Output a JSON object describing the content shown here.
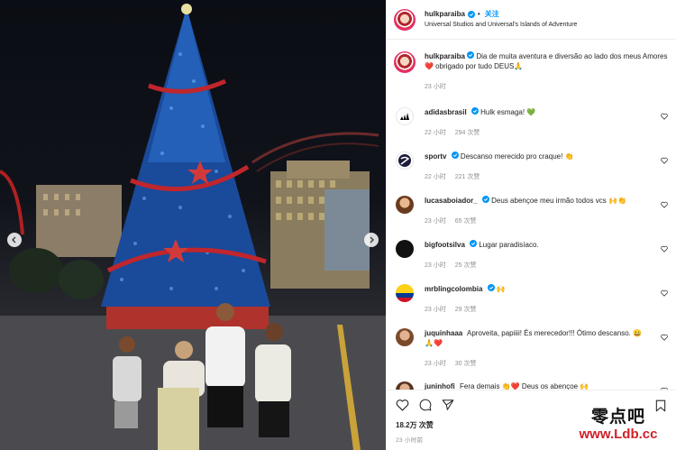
{
  "header": {
    "username": "hulkparaiba",
    "follow_label": "关注",
    "location": "Universal Studios and Universal's Islands of Adventure"
  },
  "caption": {
    "username": "hulkparaiba",
    "text": "Dia de muita aventura e diversão ao lado dos meus Amores❤️ obrigado por tudo DEUS🙏",
    "time": "23 小时"
  },
  "comments": [
    {
      "username": "adidasbrasil",
      "verified": true,
      "text": "Hulk esmaga! 💚",
      "time": "22 小时",
      "likes": "294 次赞"
    },
    {
      "username": "sportv",
      "verified": true,
      "text": "Descanso merecido pro craque! 👏",
      "time": "22 小时",
      "likes": "221 次赞"
    },
    {
      "username": "lucasaboiador_",
      "verified": true,
      "text": "Deus abençoe meu irmão todos vcs 🙌👏",
      "time": "23 小时",
      "likes": "65 次赞"
    },
    {
      "username": "bigfootsilva",
      "verified": true,
      "text": "Lugar paradisíaco.",
      "time": "23 小时",
      "likes": "25 次赞"
    },
    {
      "username": "mrblingcolombia",
      "verified": true,
      "text": "🙌",
      "time": "23 小时",
      "likes": "29 次赞"
    },
    {
      "username": "juquinhaaa",
      "verified": false,
      "text": "Aproveita, papiiii! És merecedor!!! Ótimo descanso. 😀🙏❤️",
      "time": "23 小时",
      "likes": "30 次赞"
    },
    {
      "username": "juninhofi",
      "verified": false,
      "text": "Fera demais 👏❤️ Deus os abençoe 🙌",
      "time": "",
      "likes": ""
    }
  ],
  "actions": {
    "likes": "18.2万 次赞",
    "date": "23 小时前"
  },
  "watermark": {
    "chinese": "零点吧",
    "url": "www.Ldb.cc"
  },
  "colors": {
    "accent": "#0095f6",
    "verified": "#0095f6",
    "meta": "#8e8e8e",
    "watermark_red": "#d01f28"
  },
  "icons": [
    "chevron-left-icon",
    "chevron-right-icon",
    "verified-icon",
    "heart-icon",
    "comment-icon",
    "share-icon",
    "bookmark-icon"
  ]
}
